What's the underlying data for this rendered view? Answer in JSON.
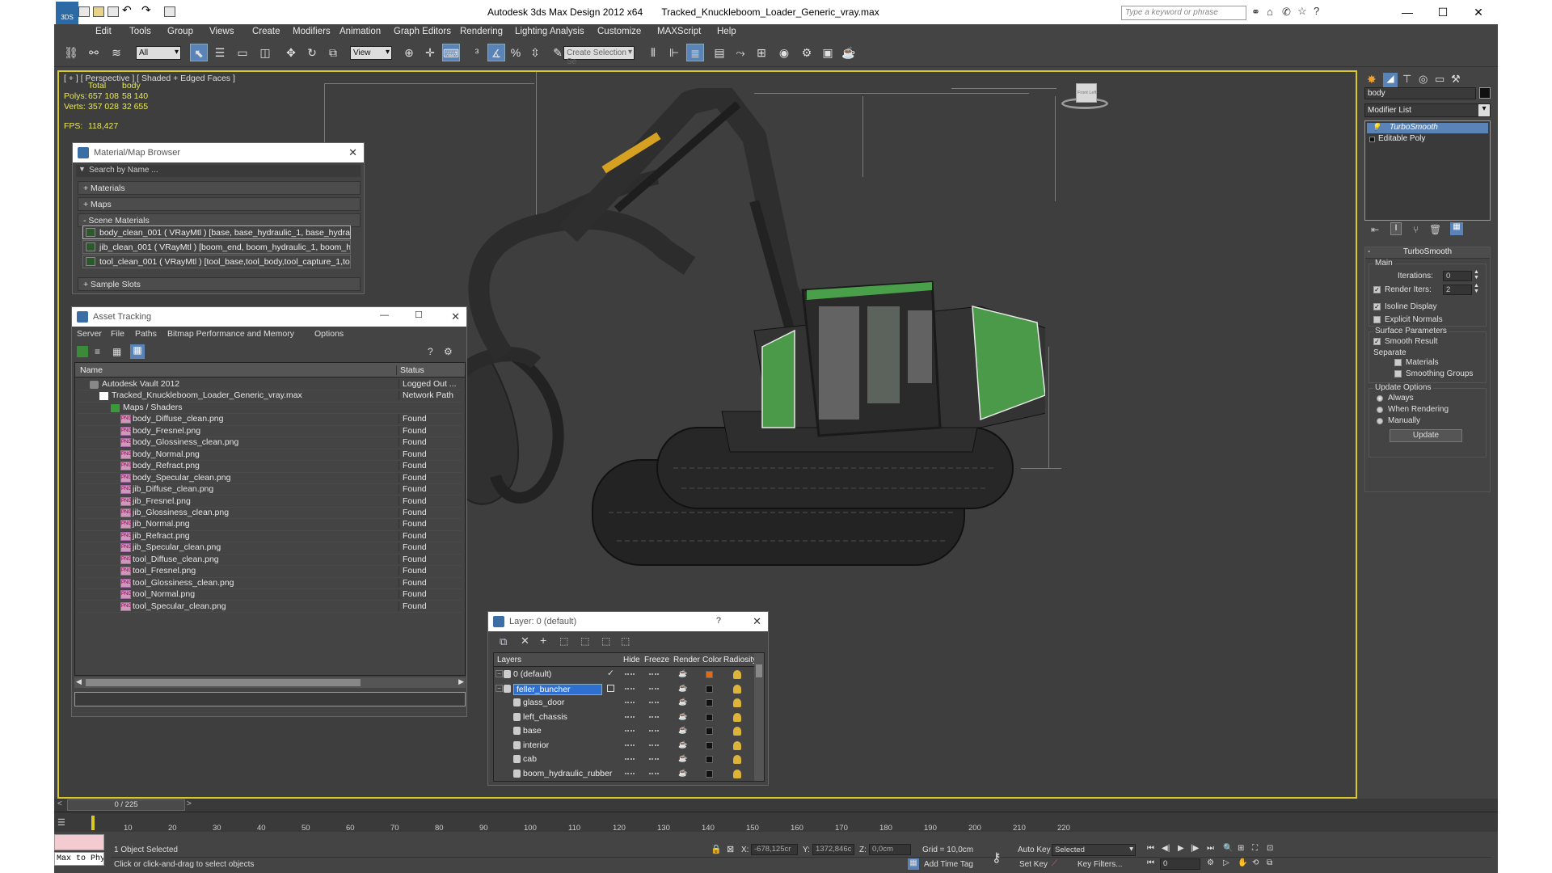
{
  "titlebar": {
    "title": "Autodesk 3ds Max Design 2012 x64       Tracked_Knuckleboom_Loader_Generic_vray.max",
    "search_placeholder": "Type a keyword or phrase",
    "logo_text": "3DS"
  },
  "menu": [
    "Edit",
    "Tools",
    "Group",
    "Views",
    "Create",
    "Modifiers",
    "Animation",
    "Graph Editors",
    "Rendering",
    "Lighting Analysis",
    "Customize",
    "MAXScript",
    "Help"
  ],
  "toolbar": {
    "filter": "All",
    "ref_coord": "View",
    "selection_set": "Create Selection Se"
  },
  "viewport": {
    "label": "[ + ] [ Perspective ] [ Shaded + Edged Faces ]",
    "stats": {
      "h_total": "Total",
      "h_body": "body",
      "polys_label": "Polys:",
      "polys_total": "657 108",
      "polys_body": "58 140",
      "verts_label": "Verts:",
      "verts_total": "357 028",
      "verts_body": "32 655",
      "fps_label": "FPS:",
      "fps": "118,427"
    },
    "viewcube": {
      "front": "Front",
      "left": "Left"
    }
  },
  "material_browser": {
    "title": "Material/Map Browser",
    "search": "Search by Name ...",
    "rollouts": {
      "materials": "+ Materials",
      "maps": "+ Maps",
      "scene": "- Scene Materials",
      "samples": "+ Sample Slots"
    },
    "items": [
      "body_clean_001 ( VRayMtl ) [base, base_hydraulic_1, base_hydraulic_2, base_...",
      "jib_clean_001 ( VRayMtl ) [boom_end, boom_hydraulic_1, boom_hydraulic_2, b...",
      "tool_clean_001 ( VRayMtl ) [tool_base,tool_body,tool_capture_1,tool_capture..."
    ]
  },
  "asset_tracking": {
    "title": "Asset Tracking",
    "menu": [
      "Server",
      "File",
      "Paths",
      "Bitmap Performance and Memory",
      "Options"
    ],
    "col_name": "Name",
    "col_status": "Status",
    "vault": {
      "name": "Autodesk Vault 2012",
      "status": "Logged Out ..."
    },
    "file": {
      "name": "Tracked_Knuckleboom_Loader_Generic_vray.max",
      "status": "Network Path"
    },
    "folder": "Maps / Shaders",
    "png_tag": "PNG",
    "maps": [
      {
        "name": "body_Diffuse_clean.png",
        "status": "Found"
      },
      {
        "name": "body_Fresnel.png",
        "status": "Found"
      },
      {
        "name": "body_Glossiness_clean.png",
        "status": "Found"
      },
      {
        "name": "body_Normal.png",
        "status": "Found"
      },
      {
        "name": "body_Refract.png",
        "status": "Found"
      },
      {
        "name": "body_Specular_clean.png",
        "status": "Found"
      },
      {
        "name": "jib_Diffuse_clean.png",
        "status": "Found"
      },
      {
        "name": "jib_Fresnel.png",
        "status": "Found"
      },
      {
        "name": "jib_Glossiness_clean.png",
        "status": "Found"
      },
      {
        "name": "jib_Normal.png",
        "status": "Found"
      },
      {
        "name": "jib_Refract.png",
        "status": "Found"
      },
      {
        "name": "jib_Specular_clean.png",
        "status": "Found"
      },
      {
        "name": "tool_Diffuse_clean.png",
        "status": "Found"
      },
      {
        "name": "tool_Fresnel.png",
        "status": "Found"
      },
      {
        "name": "tool_Glossiness_clean.png",
        "status": "Found"
      },
      {
        "name": "tool_Normal.png",
        "status": "Found"
      },
      {
        "name": "tool_Specular_clean.png",
        "status": "Found"
      }
    ]
  },
  "layer_dialog": {
    "title": "Layer: 0 (default)",
    "help": "?",
    "cols": {
      "layers": "Layers",
      "hide": "Hide",
      "freeze": "Freeze",
      "render": "Render",
      "color": "Color",
      "radiosity": "Radiosity"
    },
    "rows": [
      {
        "name": "0 (default)",
        "color": "#e06a1a"
      },
      {
        "name": "feller_buncher",
        "color": "#111111"
      },
      {
        "name": "glass_door",
        "color": "#111111"
      },
      {
        "name": "left_chassis",
        "color": "#111111"
      },
      {
        "name": "base",
        "color": "#111111"
      },
      {
        "name": "interior",
        "color": "#111111"
      },
      {
        "name": "cab",
        "color": "#111111"
      },
      {
        "name": "boom_hydraulic_rubber",
        "color": "#111111"
      }
    ]
  },
  "command_panel": {
    "object_name": "body",
    "modifier_list": "Modifier List",
    "stack": [
      "TurboSmooth",
      "Editable Poly"
    ],
    "turbosmooth": {
      "title": "TurboSmooth",
      "main": "Main",
      "iterations_label": "Iterations:",
      "iterations": "0",
      "render_iters_label": "Render Iters:",
      "render_iters": "2",
      "isoline": "Isoline Display",
      "explicit": "Explicit Normals",
      "surface": "Surface Parameters",
      "smooth": "Smooth Result",
      "separate": "Separate",
      "materials": "Materials",
      "smoothing": "Smoothing Groups",
      "update_options": "Update Options",
      "always": "Always",
      "when_rendering": "When Rendering",
      "manually": "Manually",
      "update": "Update"
    }
  },
  "timeline": {
    "frame": "0 / 225",
    "ticks": [
      "10",
      "20",
      "30",
      "40",
      "50",
      "60",
      "70",
      "80",
      "90",
      "100",
      "110",
      "120",
      "130",
      "140",
      "150",
      "160",
      "170",
      "180",
      "190",
      "200",
      "210",
      "220"
    ]
  },
  "status": {
    "maxscript": "Max to Physc",
    "selected": "1 Object Selected",
    "prompt": "Click or click-and-drag to select objects",
    "x_label": "X:",
    "x": "-678,125cr",
    "y_label": "Y:",
    "y": "1372,846c",
    "z_label": "Z:",
    "z": "0,0cm",
    "grid": "Grid = 10,0cm",
    "auto_key": "Auto Key",
    "set_key": "Set Key",
    "key_mode": "Selected",
    "key_filters": "Key Filters...",
    "add_time_tag": "Add Time Tag",
    "frame": "0"
  }
}
